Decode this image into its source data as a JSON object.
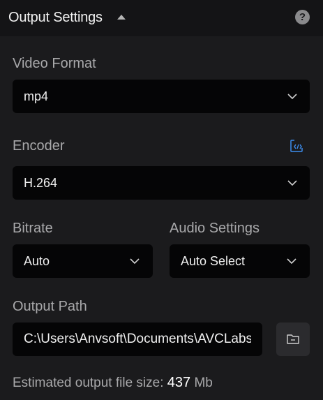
{
  "header": {
    "title": "Output Settings",
    "help_glyph": "?"
  },
  "video_format": {
    "label": "Video Format",
    "value": "mp4"
  },
  "encoder": {
    "label": "Encoder",
    "value": "H.264",
    "settings_icon": "code-settings-icon"
  },
  "bitrate": {
    "label": "Bitrate",
    "value": "Auto"
  },
  "audio_settings": {
    "label": "Audio Settings",
    "value": "Auto Select"
  },
  "output_path": {
    "label": "Output Path",
    "value": "C:\\Users\\Anvsoft\\Documents\\AVCLabs"
  },
  "estimate": {
    "prefix": "Estimated output file size:",
    "size": "437",
    "unit": "Mb"
  },
  "colors": {
    "background": "#1b1b1d",
    "header_background": "#141416",
    "field_background": "#050506",
    "accent": "#3d8ef0",
    "label_text": "#a9a9ab"
  }
}
